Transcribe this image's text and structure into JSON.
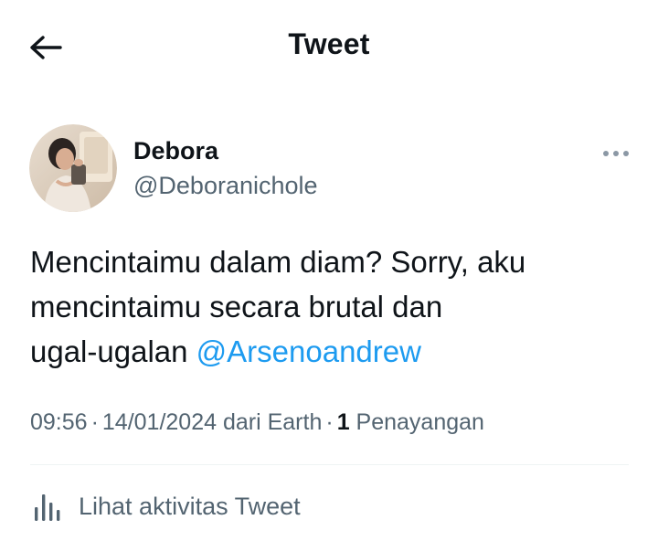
{
  "header": {
    "back_icon": "arrow-left-icon",
    "title": "Tweet"
  },
  "author": {
    "avatar_icon": "avatar-photo",
    "display_name": "Debora",
    "handle": "@Deboranichole",
    "more_icon": "more-dots-icon"
  },
  "tweet": {
    "line1": "Mencintaimu dalam diam? Sorry, aku",
    "line2": "mencintaimu secara brutal dan",
    "line3_text": "ugal-ugalan",
    "mention": "@Arsenoandrew",
    "mention_color": "#1d9bf0"
  },
  "meta": {
    "time": "09:56",
    "separator": "·",
    "date": "14/01/2024",
    "source": "dari Earth",
    "views_count": "1",
    "views_label": "Penayangan"
  },
  "activity": {
    "icon": "bar-chart-icon",
    "label": "Lihat aktivitas Tweet"
  }
}
